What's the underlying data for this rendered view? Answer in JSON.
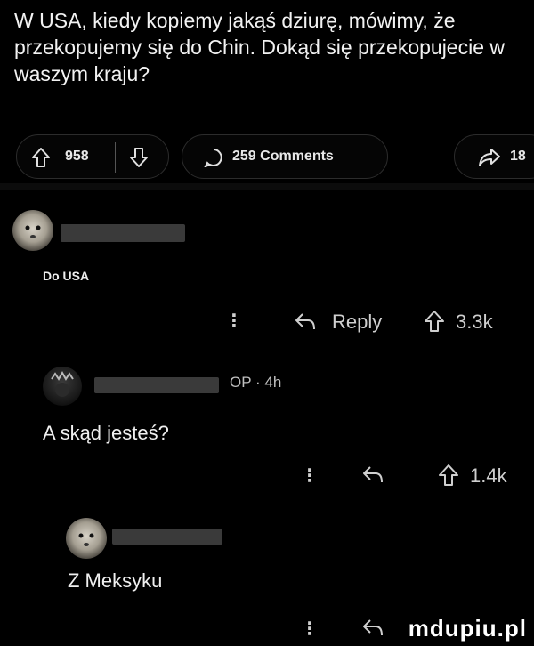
{
  "post": {
    "title": "W USA, kiedy kopiemy jakąś dziurę, mówimy, że przekopujemy się do Chin. Dokąd się przekopujecie w waszym kraju?",
    "upvotes": "958",
    "comments_label": "259 Comments",
    "share_count": "18"
  },
  "comments": [
    {
      "text": "Do USA",
      "reply_label": "Reply",
      "upvotes": "3.3k"
    },
    {
      "op_tag": "OP",
      "time": "4h",
      "text": "A skąd jesteś?",
      "upvotes": "1.4k"
    },
    {
      "text": "Z Meksyku"
    }
  ],
  "icons": {
    "upvote": "upvote-arrow-icon",
    "downvote": "downvote-arrow-icon",
    "comment": "comment-bubble-icon",
    "share": "share-arrow-icon",
    "reply": "reply-arrow-icon",
    "more": "more-dots-icon"
  },
  "watermark": "mdupiu.pl",
  "colors": {
    "background": "#000000",
    "text": "#ffffff",
    "muted": "#cfcfcf"
  }
}
